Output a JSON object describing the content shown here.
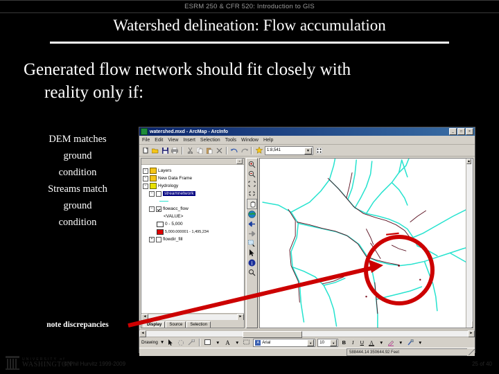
{
  "header": {
    "course": "ESRM 250 & CFR 520: Introduction to GIS",
    "title": "Watershed delineation: Flow accumulation"
  },
  "slide": {
    "bullet_line1": "Generated flow network should fit closely with",
    "bullet_line2": "reality only if:",
    "sub_points": [
      "DEM matches",
      "ground",
      "condition",
      "Streams match",
      "ground",
      "condition"
    ],
    "annotation": "note discrepancies"
  },
  "footer": {
    "logo_line1": "UNIVERSITY of",
    "logo_line2": "WASHINGTON",
    "copyright": "© Phil Hurvitz 1999-2009",
    "page": "25 of 40"
  },
  "arcmap": {
    "title": "watershed.mxd - ArcMap - ArcInfo",
    "window_buttons": [
      "_",
      "□",
      "×"
    ],
    "menus": [
      "File",
      "Edit",
      "View",
      "Insert",
      "Selection",
      "Tools",
      "Window",
      "Help"
    ],
    "toolbar": {
      "buttons": [
        "new-document",
        "open",
        "save",
        "print",
        "cut",
        "copy",
        "paste",
        "delete",
        "undo",
        "redo",
        "add-data"
      ],
      "scale_value": "1:8,541",
      "scale_arrow": "▼"
    },
    "toc": {
      "collapse_glyph": "×",
      "nodes": [
        {
          "expander": "−",
          "icon": "frame",
          "label": "Layers",
          "indent": 0
        },
        {
          "expander": "−",
          "icon": "frame",
          "label": "New Data Frame",
          "indent": 0
        },
        {
          "expander": "−",
          "icon": "frame",
          "label": "Hydrology",
          "indent": 0
        },
        {
          "expander": "−",
          "icon": "check-off",
          "label": "streamnetwork",
          "indent": 1,
          "selected": true
        },
        {
          "expander": "−",
          "icon": "check-on",
          "label": "flowacc_flow",
          "indent": 1
        },
        {
          "expander": "",
          "icon": "none",
          "label": "<VALUE>",
          "indent": 3
        },
        {
          "expander": "",
          "icon": "swatch-white",
          "label": "0 - 5,000",
          "indent": 2
        },
        {
          "expander": "",
          "icon": "swatch-red",
          "label": "5,000.000001 - 1,495,234",
          "indent": 2
        },
        {
          "expander": "+",
          "icon": "check-off",
          "label": "flowdir_fill",
          "indent": 1
        }
      ],
      "scroll_left": "◄",
      "scroll_right": "►",
      "tabs": [
        "Display",
        "Source",
        "Selection"
      ],
      "active_tab": "Display"
    },
    "tools": [
      "zoom-in",
      "zoom-out",
      "pan",
      "fixed-zoom-in",
      "fixed-zoom-out",
      "full-extent",
      "globe",
      "go-back",
      "go-forward",
      "select-features",
      "select-elements",
      "identify",
      "find"
    ],
    "drawing": {
      "label": "Drawing",
      "arrow": "▼",
      "font_name": "Arial",
      "font_size": "10",
      "bold": "B",
      "italic": "I",
      "underline": "U"
    },
    "status": "588444.14  350644.92 Feet"
  },
  "colors": {
    "stream_cyan": "#27e3cf",
    "actual_stream": "#5a1020",
    "highlight_red": "#cc0000",
    "title_blue": "#0a246a",
    "chrome_gray": "#d4d0c8"
  }
}
